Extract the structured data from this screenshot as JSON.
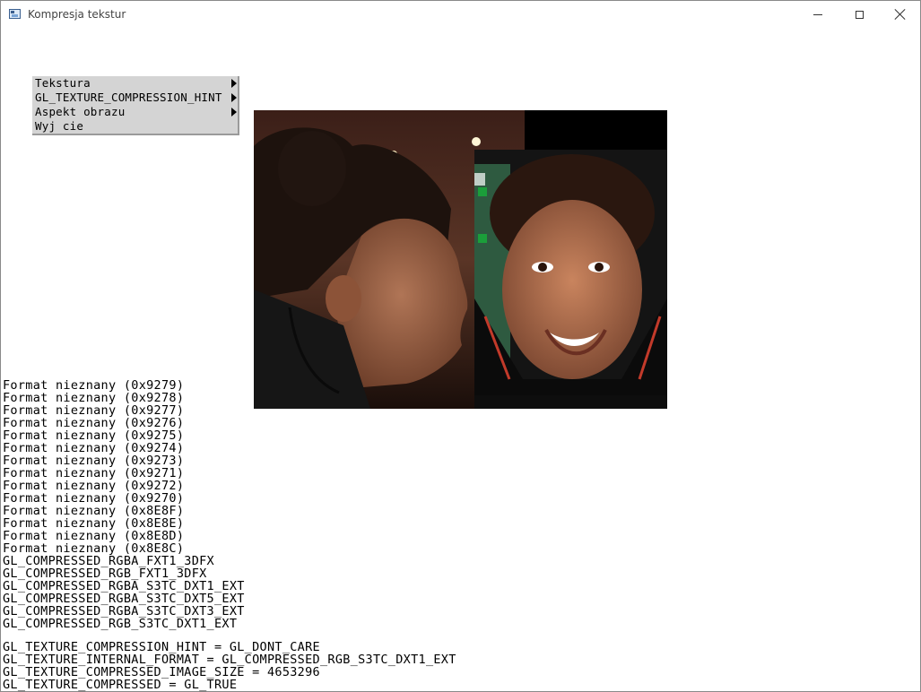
{
  "window": {
    "title": "Kompresja tekstur"
  },
  "menu": {
    "items": [
      {
        "label": "Tekstura",
        "has_submenu": true
      },
      {
        "label": "GL_TEXTURE_COMPRESSION_HINT",
        "has_submenu": true
      },
      {
        "label": "Aspekt obrazu",
        "has_submenu": true
      },
      {
        "label": "Wyj cie",
        "has_submenu": false
      }
    ]
  },
  "formats": [
    "Format nieznany (0x9279)",
    "Format nieznany (0x9278)",
    "Format nieznany (0x9277)",
    "Format nieznany (0x9276)",
    "Format nieznany (0x9275)",
    "Format nieznany (0x9274)",
    "Format nieznany (0x9273)",
    "Format nieznany (0x9271)",
    "Format nieznany (0x9272)",
    "Format nieznany (0x9270)",
    "Format nieznany (0x8E8F)",
    "Format nieznany (0x8E8E)",
    "Format nieznany (0x8E8D)",
    "Format nieznany (0x8E8C)",
    "GL_COMPRESSED_RGBA_FXT1_3DFX",
    "GL_COMPRESSED_RGB_FXT1_3DFX",
    "GL_COMPRESSED_RGBA_S3TC_DXT1_EXT",
    "GL_COMPRESSED_RGBA_S3TC_DXT5_EXT",
    "GL_COMPRESSED_RGBA_S3TC_DXT3_EXT",
    "GL_COMPRESSED_RGB_S3TC_DXT1_EXT"
  ],
  "status": [
    "GL_TEXTURE_COMPRESSION_HINT = GL_DONT_CARE",
    "GL_TEXTURE_INTERNAL_FORMAT = GL_COMPRESSED_RGB_S3TC_DXT1_EXT",
    "GL_TEXTURE_COMPRESSED_IMAGE_SIZE = 4653296",
    "GL_TEXTURE_COMPRESSED = GL_TRUE"
  ]
}
